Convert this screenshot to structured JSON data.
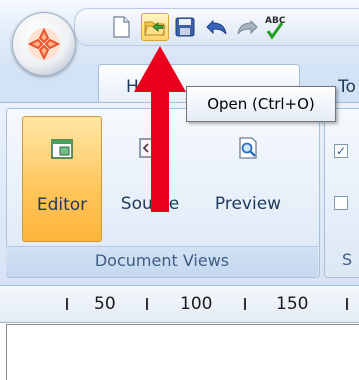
{
  "quick_access": {
    "items": [
      {
        "name": "new-document-icon"
      },
      {
        "name": "open-folder-icon",
        "active": true
      },
      {
        "name": "save-icon"
      },
      {
        "name": "undo-icon"
      },
      {
        "name": "redo-icon"
      },
      {
        "name": "spellcheck-icon"
      }
    ],
    "spellcheck_glyph": "ABC"
  },
  "tabs": {
    "home": "Home",
    "next": "To"
  },
  "tooltip": {
    "text": "Open (Ctrl+O)"
  },
  "document_views": {
    "caption": "Document Views",
    "buttons": [
      {
        "label": "Editor",
        "icon": "editor-view-icon",
        "selected": true
      },
      {
        "label": "Source",
        "icon": "source-view-icon",
        "selected": false
      },
      {
        "label": "Preview",
        "icon": "preview-view-icon",
        "selected": false
      }
    ]
  },
  "second_group": {
    "caption_fragment": "S",
    "checkbox_1_checked": true,
    "checkbox_2_checked": false
  },
  "ruler": {
    "labels": [
      "50",
      "100",
      "150"
    ]
  },
  "colors": {
    "accent_selected": "#ffc55a",
    "annotation_arrow": "#e8001c"
  }
}
